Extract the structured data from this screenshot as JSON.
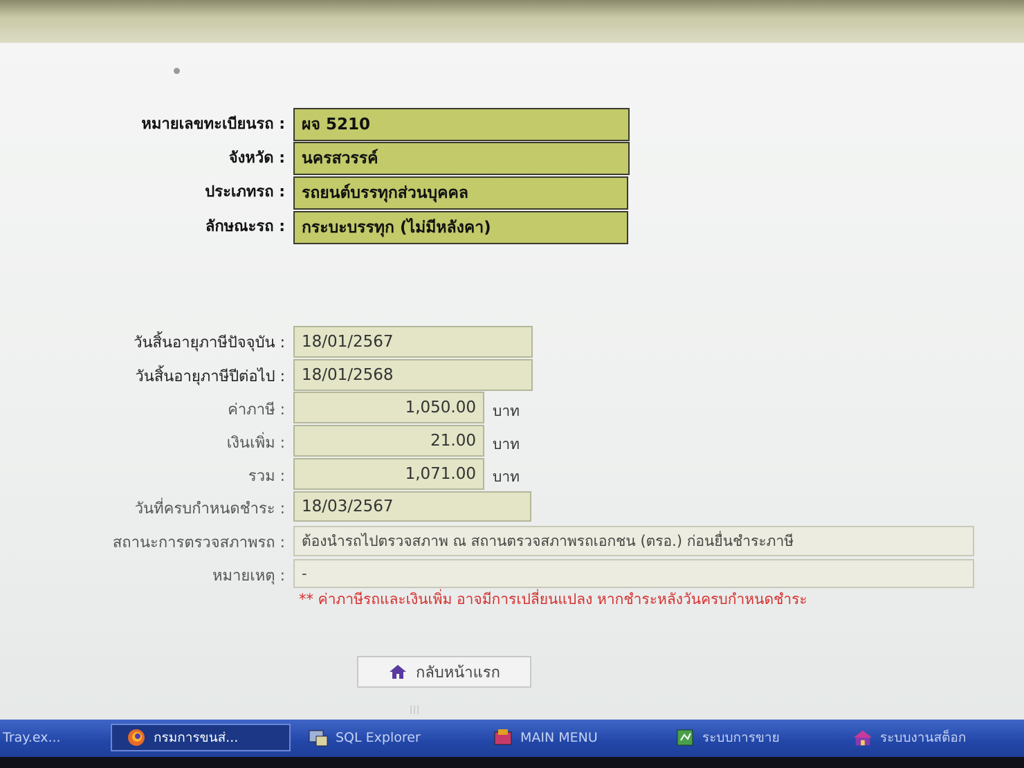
{
  "vehicle": {
    "plate_label": "หมายเลขทะเบียนรถ :",
    "plate_value": "ผจ 5210",
    "province_label": "จังหวัด :",
    "province_value": "นครสวรรค์",
    "type_label": "ประเภทรถ :",
    "type_value": "รถยนต์บรรทุกส่วนบุคคล",
    "style_label": "ลักษณะรถ :",
    "style_value": "กระบะบรรทุก (ไม่มีหลังคา)"
  },
  "tax": {
    "current_expiry_label": "วันสิ้นอายุภาษีปัจจุบัน :",
    "current_expiry_value": "18/01/2567",
    "next_expiry_label": "วันสิ้นอายุภาษีปีต่อไป :",
    "next_expiry_value": "18/01/2568",
    "fee_label": "ค่าภาษี :",
    "fee_value": "1,050.00",
    "surcharge_label": "เงินเพิ่ม :",
    "surcharge_value": "21.00",
    "total_label": "รวม :",
    "total_value": "1,071.00",
    "currency": "บาท",
    "due_label": "วันที่ครบกำหนดชำระ :",
    "due_value": "18/03/2567",
    "inspection_label": "สถานะการตรวจสภาพรถ :",
    "inspection_value": "ต้องนำรถไปตรวจสภาพ ณ สถานตรวจสภาพรถเอกชน (ตรอ.) ก่อนยื่นชำระภาษี",
    "remark_label": "หมายเหตุ :",
    "remark_value": "-",
    "warning": "** ค่าภาษีรถและเงินเพิ่ม อาจมีการเปลี่ยนแปลง หากชำระหลังวันครบกำหนดชำระ"
  },
  "home_button_label": "กลับหน้าแรก",
  "colors": {
    "highlight_field": "#c2ca6a",
    "warning_text": "#d6302f",
    "taskbar": "#2347a8"
  },
  "taskbar": {
    "items": [
      {
        "label": "Tray.ex...",
        "icon": "none"
      },
      {
        "label": "กรมการขนส่...",
        "icon": "firefox-icon"
      },
      {
        "label": "SQL Explorer",
        "icon": "sql-explorer-icon"
      },
      {
        "label": "MAIN MENU",
        "icon": "main-menu-icon"
      },
      {
        "label": "ระบบการขาย",
        "icon": "sales-system-icon"
      },
      {
        "label": "ระบบงานสต็อก",
        "icon": "stock-system-icon"
      }
    ]
  }
}
